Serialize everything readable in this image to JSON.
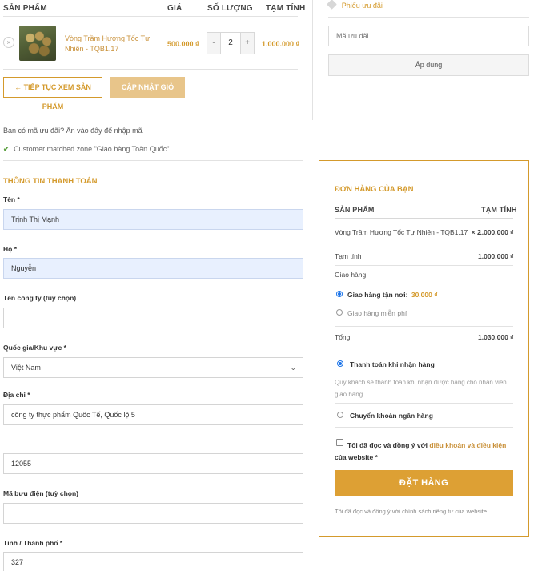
{
  "cart": {
    "col_product": "SẢN PHẨM",
    "col_price": "GIÁ",
    "col_qty": "SỐ LƯỢNG",
    "col_subtotal": "TẠM TÍNH",
    "item": {
      "remove_symbol": "×",
      "name": "Vòng Trầm Hương Tốc Tự Nhiên - TQB1.17",
      "price": "500.000 ₫",
      "qty": "2",
      "minus": "-",
      "plus": "+",
      "subtotal": "1.000.000 ₫"
    },
    "continue_label": "← TIẾP TỤC XEM SẢN PHẨM",
    "update_label": "CẬP NHẬT GIỎ HÀNG"
  },
  "coupon": {
    "title": "Phiếu ưu đãi",
    "placeholder": "Mã ưu đãi",
    "apply_label": "Áp dụng",
    "prompt": "Bạn có mã ưu đãi? Ấn vào đây để nhập mã"
  },
  "notice": {
    "text": "Customer matched zone \"Giao hàng Toàn Quốc\""
  },
  "billing": {
    "title": "THÔNG TIN THANH TOÁN",
    "first_name_label": "Tên *",
    "first_name_value": "Trịnh Thị Mạnh",
    "last_name_label": "Họ *",
    "last_name_value": "Nguyễn",
    "company_label": "Tên công ty (tuỳ chọn)",
    "company_value": "",
    "country_label": "Quốc gia/Khu vực *",
    "country_value": "Việt Nam",
    "address_label": "Địa chỉ *",
    "address_value": "công ty thực phẩm Quốc Tế, Quốc lộ 5",
    "address2_value": "12055",
    "postcode_label": "Mã bưu điện (tuỳ chọn)",
    "postcode_value": "",
    "city_label": "Tỉnh / Thành phố *",
    "city_value": "327"
  },
  "order": {
    "title": "ĐƠN HÀNG CỦA BẠN",
    "col_product": "SẢN PHẨM",
    "col_subtotal": "TẠM TÍNH",
    "item_name": "Vòng Trầm Hương Tốc Tự Nhiên - TQB1.17",
    "item_qty": "× 2",
    "item_total": "1.000.000 ₫",
    "subtotal_label": "Tạm tính",
    "subtotal_value": "1.000.000 ₫",
    "shipping_label": "Giao hàng",
    "ship_option1": "Giao hàng tận nơi:",
    "ship_option1_price": "30.000 ₫",
    "ship_option2": "Giao hàng miễn phí",
    "total_label": "Tổng",
    "total_value": "1.030.000 ₫",
    "pay_cod": "Thanh toán khi nhận hàng",
    "pay_cod_desc": "Quý khách sẽ thanh toán khi nhận được hàng cho nhân viên giao hàng.",
    "pay_bank": "Chuyển khoản ngân hàng",
    "terms_prefix": "Tôi đã đọc và đồng ý với",
    "terms_link": "điều khoản và điều kiện",
    "terms_suffix": "của",
    "terms_tail": "website *",
    "place_label": "ĐẶT HÀNG",
    "privacy_note": "Tôi đã đọc và đồng ý với chính sách riêng tư của website."
  }
}
